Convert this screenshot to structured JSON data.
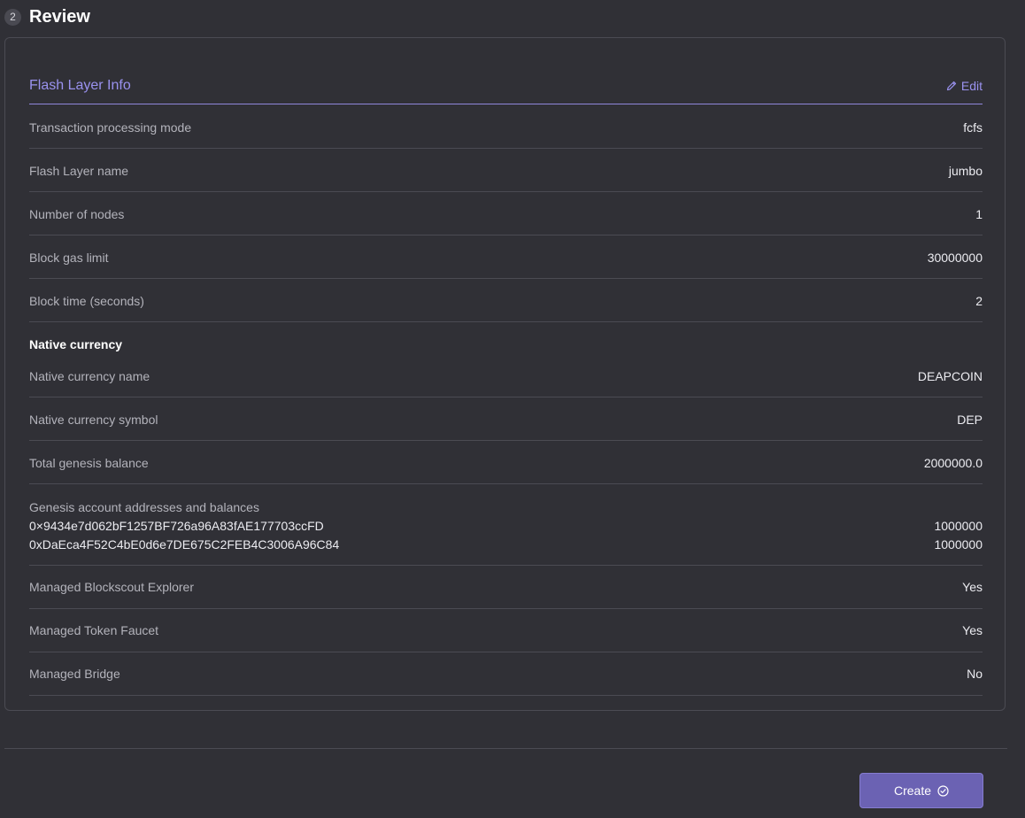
{
  "step": {
    "number": "2",
    "title": "Review"
  },
  "section": {
    "title": "Flash Layer Info",
    "edit_label": "Edit",
    "edit_icon": "pencil-icon"
  },
  "rows": [
    {
      "label": "Transaction processing mode",
      "value": "fcfs"
    },
    {
      "label": "Flash Layer name",
      "value": "jumbo"
    },
    {
      "label": "Number of nodes",
      "value": "1"
    },
    {
      "label": "Block gas limit",
      "value": "30000000"
    },
    {
      "label": "Block time (seconds)",
      "value": "2"
    }
  ],
  "native_currency": {
    "heading": "Native currency",
    "rows": [
      {
        "label": "Native currency name",
        "value": "DEAPCOIN"
      },
      {
        "label": "Native currency symbol",
        "value": "DEP"
      },
      {
        "label": "Total genesis balance",
        "value": "2000000.0"
      }
    ]
  },
  "genesis": {
    "label": "Genesis account addresses and balances",
    "accounts": [
      {
        "address": "0×9434e7d062bF1257BF726a96A83fAE177703ccFD",
        "balance": "1000000"
      },
      {
        "address": "0xDaEca4F52C4bE0d6e7DE675C2FEB4C3006A96C84",
        "balance": "1000000"
      }
    ]
  },
  "managed": [
    {
      "label": "Managed Blockscout Explorer",
      "value": "Yes"
    },
    {
      "label": "Managed Token Faucet",
      "value": "Yes"
    },
    {
      "label": "Managed Bridge",
      "value": "No"
    }
  ],
  "footer": {
    "create_label": "Create",
    "create_icon": "check-circle-icon"
  },
  "colors": {
    "background": "#303036",
    "accent": "#9a92ef",
    "button": "#6b62b3",
    "border": "#4b4b53"
  }
}
